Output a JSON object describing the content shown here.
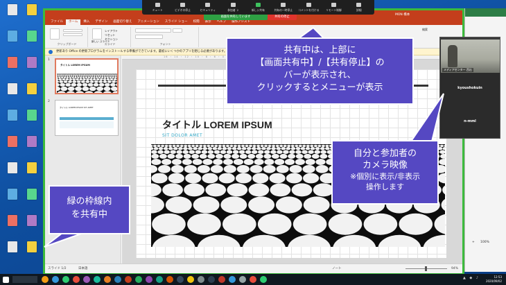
{
  "desktop": {
    "icons": [
      "icon1",
      "icon2",
      "icon3",
      "icon4",
      "icon5",
      "icon6",
      "icon7",
      "icon8",
      "icon9",
      "icon10",
      "icon11",
      "icon12",
      "icon13",
      "icon14",
      "icon15",
      "icon16",
      "icon17",
      "icon18",
      "icon19",
      "icon20"
    ]
  },
  "zoom_toolbar": {
    "buttons": [
      "ミュート",
      "ビデオの停止",
      "セキュリティ",
      "参加者",
      "新しい共有",
      "共有の一時停止",
      "コメントを付ける",
      "リモート制御",
      "詳細"
    ],
    "participants_count": "2",
    "sharing_pill": "画面を共有しています",
    "stop_pill": "共有の停止"
  },
  "powerpoint": {
    "user": "MON 橋本",
    "tabs": [
      "ファイル",
      "ホーム",
      "挿入",
      "デザイン",
      "画面切り替え",
      "アニメーション",
      "スライド ショー",
      "校閲",
      "表示",
      "ヘルプ",
      "操作アシスト"
    ],
    "active_tab": "ホーム",
    "ribbon_groups": [
      "クリップボード",
      "スライド",
      "フォント"
    ],
    "ribbon_buttons": [
      "新しい スライド",
      "レイアウト",
      "リセット",
      "セクション"
    ],
    "right_ribbon": "検索",
    "infobar": "更新あり  Office の更新プログラムをインストールする準備ができています。最初にいくつかのアプリを閉じる必要があります。",
    "ruler": "16 ・ 14 ・ 12 ・ 10 ・ 8 ・ 6 ・ 4 ・ 2 ・ 0 ・ 2 ・ 4 ・ 6 ・ 8 ・ 10 ・ 12 ・ 14 ・ 16",
    "thumbs": [
      {
        "num": "1",
        "title": "タイトル LOREM IPSUM"
      },
      {
        "num": "2",
        "title": "タイトル LOREM IPSUM SIT AMET"
      }
    ],
    "slide": {
      "title": "タイトル LOREM IPSUM",
      "subtitle": "SIT DOLOR AMET"
    },
    "status": {
      "slide_count": "スライド 1/2",
      "language": "日本語",
      "notes": "ノート",
      "zoom": "94%"
    }
  },
  "callouts": {
    "top_lines": [
      "共有中は、上部に",
      "【画面共有中】/【共有停止】の",
      "バーが表示され、",
      "クリックするとメニューが表示"
    ],
    "camera_lines": [
      "自分と参加者の",
      "カメラ映像"
    ],
    "camera_small_lines": [
      "※個別に表示/非表示",
      "操作します"
    ],
    "green_lines": [
      "緑の枠線内",
      "を共有中"
    ]
  },
  "video_panel": {
    "cam_label": "メディアセンター 西出",
    "participants": [
      "kyoushokuin",
      "n-mml"
    ]
  },
  "right_window": {
    "texts": [
      "100%",
      "+"
    ]
  },
  "taskbar": {
    "time": "12:53",
    "date": "2020/09/02"
  },
  "colors": {
    "ppt_accent": "#c43e1c",
    "share_border": "#3cba3c",
    "callout": "#5548c2",
    "stop_red": "#e0342c"
  }
}
